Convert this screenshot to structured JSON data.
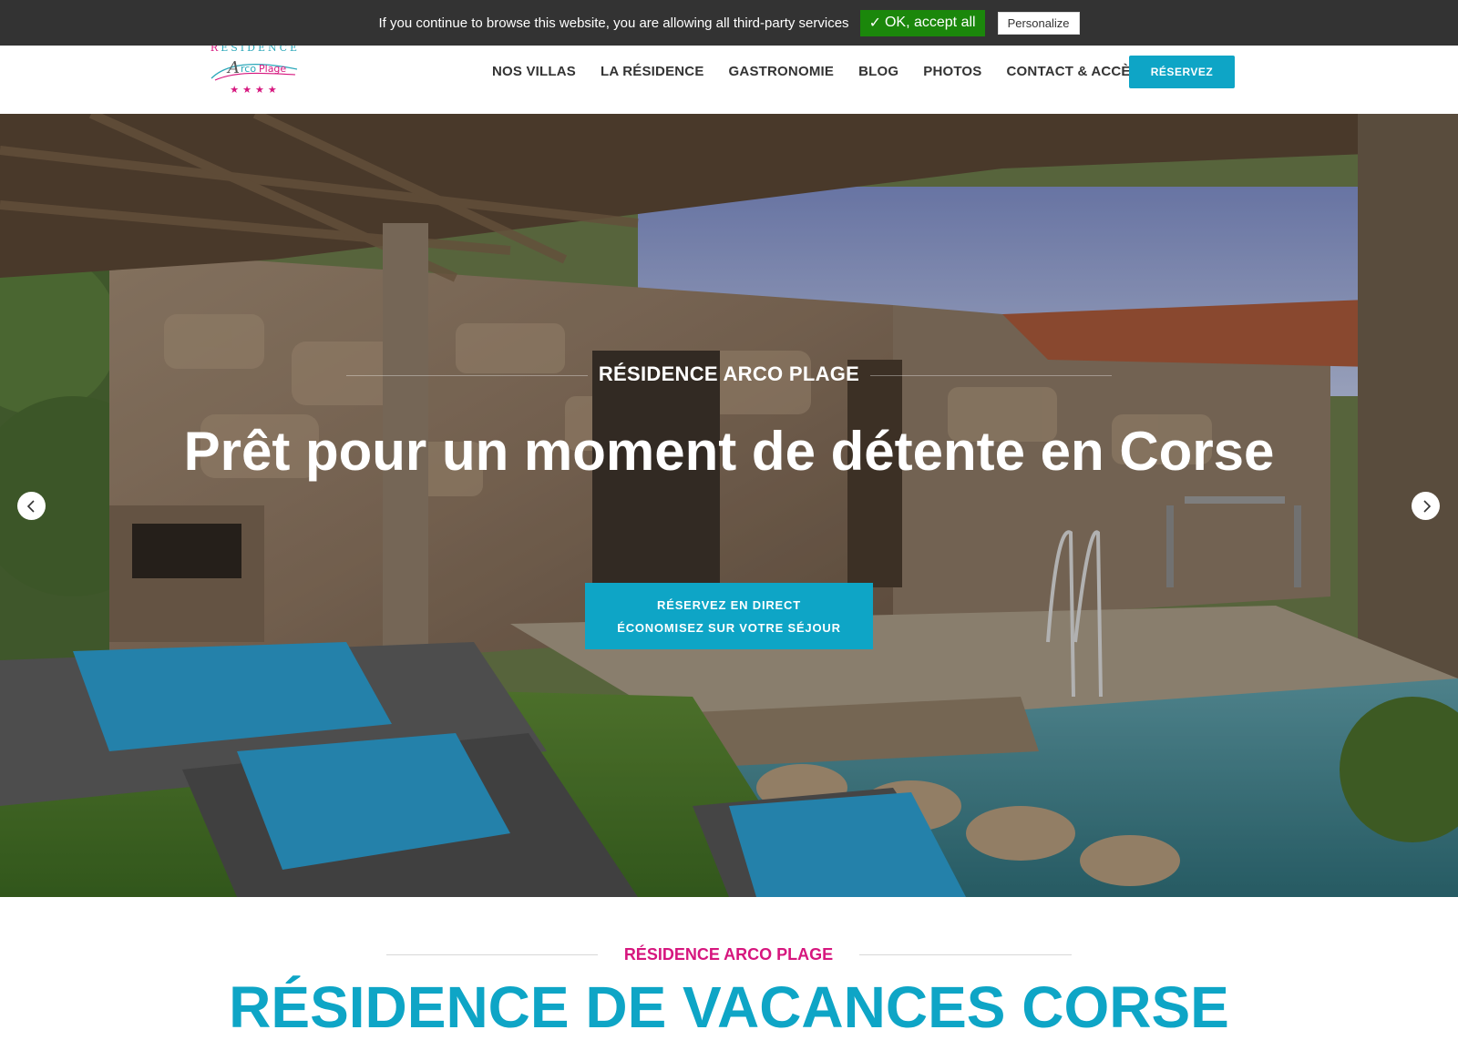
{
  "cookie_bar": {
    "message": "If you continue to browse this website, you are allowing all third-party services",
    "accept_label": "OK, accept all",
    "accept_icon": "check-icon",
    "personalize_label": "Personalize"
  },
  "header": {
    "logo": {
      "top_text_first": "R",
      "top_text_rest": "ÉSIDENCE",
      "script_text": "ArcoPlage",
      "stars": "★★★★"
    },
    "nav": [
      "NOS VILLAS",
      "LA RÉSIDENCE",
      "GASTRONOMIE",
      "BLOG",
      "PHOTOS",
      "CONTACT & ACCÈS"
    ],
    "reserve_label": "RÉSERVEZ"
  },
  "hero": {
    "kicker": "RÉSIDENCE ARCO PLAGE",
    "title": "Prêt pour un moment de détente en Corse",
    "cta_line1": "RÉSERVEZ EN DIRECT",
    "cta_line2": "ÉCONOMISEZ SUR VOTRE SÉJOUR",
    "prev_icon": "chevron-left-icon",
    "next_icon": "chevron-right-icon"
  },
  "intro": {
    "kicker": "RÉSIDENCE ARCO PLAGE",
    "title": "RÉSIDENCE DE VACANCES CORSE"
  },
  "colors": {
    "accent": "#0ea5c6",
    "brand_pink": "#d6167e",
    "cookie_bar_bg": "#333333",
    "accept_green": "#1B870B"
  }
}
